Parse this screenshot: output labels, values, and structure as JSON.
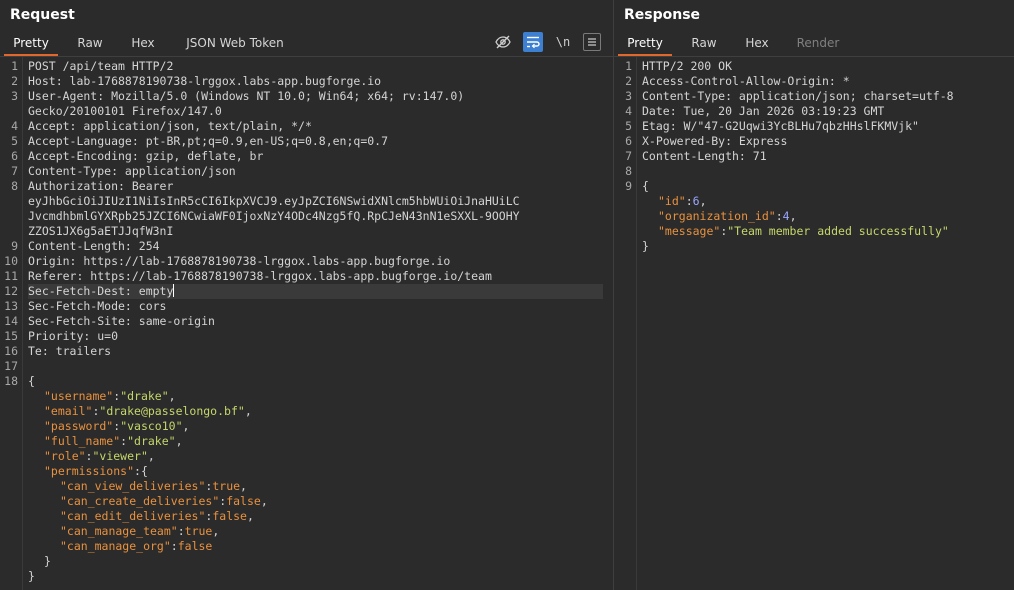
{
  "request": {
    "title": "Request",
    "tabs": [
      "Pretty",
      "Raw",
      "Hex",
      "JSON Web Token"
    ],
    "icons": {
      "hide": "eye-slash-icon",
      "wrap": "word-wrap-icon",
      "newline_label": "\\n",
      "menu": "menu-icon"
    },
    "line_numbers": [
      "1",
      "2",
      "3",
      "4",
      "5",
      "6",
      "7",
      "8",
      "9",
      "10",
      "11",
      "12",
      "13",
      "14",
      "15",
      "16",
      "17",
      "18"
    ],
    "lines": {
      "l1": "POST /api/team HTTP/2",
      "l2": "Host: lab-1768878190738-lrggox.labs-app.bugforge.io",
      "l3a": "User-Agent: Mozilla/5.0 (Windows NT 10.0; Win64; x64; rv:147.0)",
      "l3b": "Gecko/20100101 Firefox/147.0",
      "l4": "Accept: application/json, text/plain, */*",
      "l5": "Accept-Language: pt-BR,pt;q=0.9,en-US;q=0.8,en;q=0.7",
      "l6": "Accept-Encoding: gzip, deflate, br",
      "l7": "Content-Type: application/json",
      "l8a": "Authorization: Bearer",
      "l8b": "eyJhbGciOiJIUzI1NiIsInR5cCI6IkpXVCJ9.eyJpZCI6NSwidXNlcm5hbWUiOiJnaHUiLC",
      "l8c": "JvcmdhbmlGYXRpb25JZCI6NCwiaWF0IjoxNzY4ODc4Nzg5fQ.RpCJeN43nN1eSXXL-9OOHY",
      "l8d": "ZZOS1JX6g5aETJJqfW3nI",
      "l9": "Content-Length: 254",
      "l10": "Origin: https://lab-1768878190738-lrggox.labs-app.bugforge.io",
      "l11": "Referer: https://lab-1768878190738-lrggox.labs-app.bugforge.io/team",
      "l12": "Sec-Fetch-Dest: empty",
      "l13": "Sec-Fetch-Mode: cors",
      "l14": "Sec-Fetch-Site: same-origin",
      "l15": "Priority: u=0",
      "l16": "Te: trailers",
      "j_open": "{",
      "j_username_k": "\"username\"",
      "j_username_v": "\"drake\"",
      "j_email_k": "\"email\"",
      "j_email_v": "\"drake@passelongo.bf\"",
      "j_password_k": "\"password\"",
      "j_password_v": "\"vasco10\"",
      "j_fullname_k": "\"full_name\"",
      "j_fullname_v": "\"drake\"",
      "j_role_k": "\"role\"",
      "j_role_v": "\"viewer\"",
      "j_perm_k": "\"permissions\"",
      "p_view_k": "\"can_view_deliveries\"",
      "p_view_v": "true",
      "p_create_k": "\"can_create_deliveries\"",
      "p_create_v": "false",
      "p_edit_k": "\"can_edit_deliveries\"",
      "p_edit_v": "false",
      "p_team_k": "\"can_manage_team\"",
      "p_team_v": "true",
      "p_org_k": "\"can_manage_org\"",
      "p_org_v": "false",
      "j_inner_close": "}",
      "j_close": "}"
    }
  },
  "response": {
    "title": "Response",
    "tabs": [
      "Pretty",
      "Raw",
      "Hex",
      "Render"
    ],
    "line_numbers": [
      "1",
      "2",
      "3",
      "4",
      "5",
      "6",
      "7",
      "8",
      "9"
    ],
    "lines": {
      "r1": "HTTP/2 200 OK",
      "r2": "Access-Control-Allow-Origin: *",
      "r3": "Content-Type: application/json; charset=utf-8",
      "r4": "Date: Tue, 20 Jan 2026 03:19:23 GMT",
      "r5": "Etag: W/\"47-G2Uqwi3YcBLHu7qbzHHslFKMVjk\"",
      "r6": "X-Powered-By: Express",
      "r7": "Content-Length: 71",
      "j_open": "{",
      "id_k": "\"id\"",
      "id_v": "6",
      "org_k": "\"organization_id\"",
      "org_v": "4",
      "msg_k": "\"message\"",
      "msg_v": "\"Team member added successfully\"",
      "j_close": "}"
    }
  },
  "colors": {
    "background": "#2b2b2b",
    "active_tab_underline": "#e0672d",
    "json_key": "#e8913e",
    "json_string": "#c6d66a",
    "json_number": "#9aa7ff",
    "wrap_button": "#3d7fd1"
  }
}
